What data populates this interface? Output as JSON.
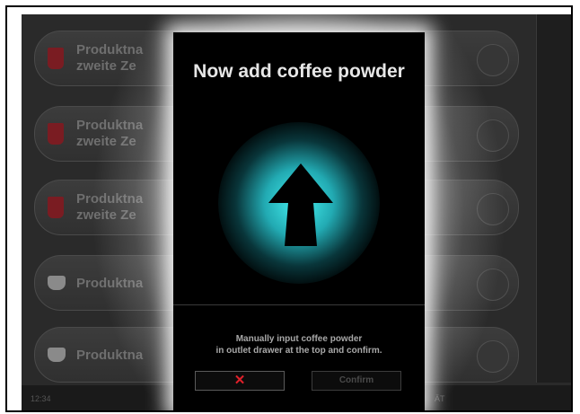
{
  "products": [
    {
      "line1": "Produktna",
      "line2": "zweite Ze",
      "cup": "red-cup-icon"
    },
    {
      "line1": "Produktna",
      "line2": "zweite Ze",
      "cup": "red-cup-icon"
    },
    {
      "line1": "Produktna",
      "line2": "zweite Ze",
      "cup": "red-cup-icon"
    },
    {
      "line1": "Produktna",
      "line2": "",
      "cup": "white-cup-icon"
    },
    {
      "line1": "Produktna",
      "line2": "",
      "cup": "white-cup-icon"
    }
  ],
  "footer": {
    "left": "12:34",
    "right": "ÄT"
  },
  "dialog": {
    "title": "Now add coffee powder",
    "icon": "up-arrow-icon",
    "instructions_line1": "Manually input coffee powder",
    "instructions_line2": "in outlet drawer at the top and confirm.",
    "cancel_symbol": "✕",
    "confirm_label": "Confirm",
    "accent_color": "#3fe6ea",
    "cancel_color": "#e0202a"
  }
}
